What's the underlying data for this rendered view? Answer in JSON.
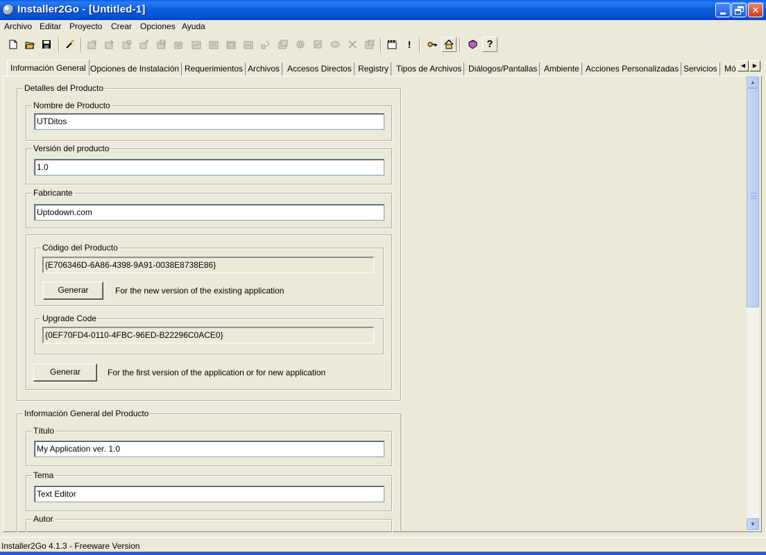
{
  "window": {
    "title": "Installer2Go - [Untitled-1]",
    "minimize_glyph": "_",
    "close_glyph": "✕"
  },
  "menu": [
    "Archivo",
    "Editar",
    "Proyecto",
    "Crear",
    "Opciones",
    "Ayuda"
  ],
  "toolbar": {
    "icons": [
      "new-file-icon",
      "open-folder-icon",
      "save-disk-icon",
      "magic-wand-icon",
      "build-icon",
      "build-icon",
      "build-icon",
      "build-icon",
      "build-icon",
      "build-icon",
      "build-icon",
      "build-icon",
      "build-icon",
      "build-icon",
      "build-icon",
      "build-icon",
      "build-icon",
      "build-icon",
      "build-icon",
      "delete-icon",
      "properties-icon",
      "clapper-icon",
      "exclamation-icon",
      "key-icon",
      "home-icon",
      "book-icon",
      "help-icon"
    ],
    "exclamation": "!",
    "help": "?"
  },
  "tabs": [
    "Información General",
    "Opciones de Instalación",
    "Requerimientos",
    "Archivos",
    "Accesos Directos",
    "Registry",
    "Tipos de Archivos",
    "Diálogos/Pantallas",
    "Ambiente",
    "Acciones Personalizadas",
    "Servicios",
    "Mó"
  ],
  "tab_scroll": {
    "left": "◀",
    "right": "▶"
  },
  "product_details": {
    "legend": "Detalles del Producto",
    "product_name": {
      "label": "Nombre de Producto",
      "value": "UTDitos"
    },
    "product_version": {
      "label": "Versión del producto",
      "value": "1.0"
    },
    "manufacturer": {
      "label": "Fabricante",
      "value": "Uptodown.com"
    },
    "product_code": {
      "label": "Código del Producto",
      "value": "{E706346D-6A86-4398-9A91-0038E8738E86}",
      "button": "Generar",
      "note": "For the new version of the existing application"
    },
    "upgrade_code": {
      "label": "Upgrade Code",
      "value": "{0EF70FD4-0110-4FBC-96ED-B22296C0ACE0}",
      "button": "Generar",
      "note": "For the first version of the application or for new application"
    }
  },
  "general_info": {
    "legend": "Información General del Producto",
    "title": {
      "label": "Título",
      "value": "My Application ver. 1.0"
    },
    "subject": {
      "label": "Tema",
      "value": "Text Editor"
    },
    "author": {
      "label": "Autor"
    }
  },
  "scrollbar": {
    "up": "▲",
    "down": "▼"
  },
  "status": "Installer2Go 4.1.3 - Freeware Version"
}
